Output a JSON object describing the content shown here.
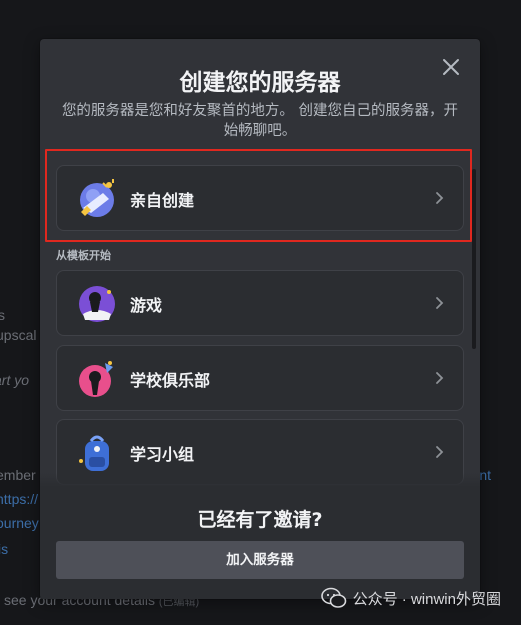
{
  "modal": {
    "title": "创建您的服务器",
    "subtitle": "您的服务器是您和好友聚首的地方。 创建您自己的服务器，开始畅聊吧。",
    "create_own": {
      "label": "亲自创建",
      "icon": "globe-sparkle-icon"
    },
    "template_section_label": "从模板开始",
    "templates": [
      {
        "label": "游戏",
        "icon": "gaming-icon"
      },
      {
        "label": "学校俱乐部",
        "icon": "school-club-icon"
      },
      {
        "label": "学习小组",
        "icon": "study-backpack-icon"
      }
    ],
    "footer": {
      "title": "已经有了邀请?",
      "join_button": "加入服务器"
    }
  },
  "background": {
    "lines": [
      "s",
      "upscal",
      "art yo",
      "ember",
      "https://",
      "ourney",
      "is"
    ],
    "bottom_text": "see your account details",
    "bottom_note": "(已编辑)",
    "right_link": "nt"
  },
  "watermark": {
    "text": "公众号 · winwin外贸圈"
  },
  "colors": {
    "modal_bg": "#313338",
    "card_bg": "#2b2d31",
    "highlight": "#e0281f",
    "button_bg": "#4e5058",
    "text_primary": "#f2f3f5",
    "text_secondary": "#b5bac1"
  }
}
